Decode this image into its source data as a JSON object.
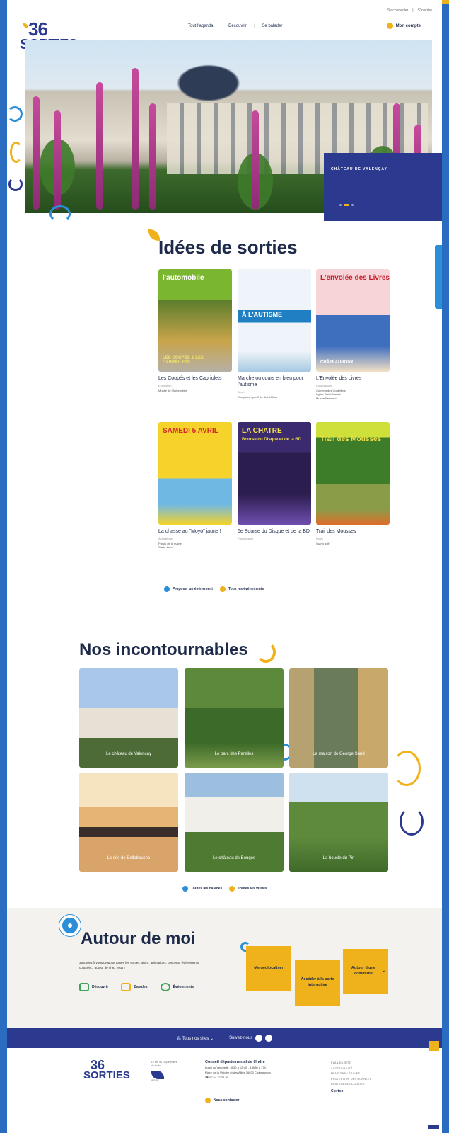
{
  "header": {
    "utility_links": [
      "Se connecter",
      "S'inscrire"
    ],
    "logo": {
      "line1": "36",
      "line2": "SORTIES"
    },
    "nav": [
      "Tout l'agenda",
      "Découvrir",
      "Se balader"
    ],
    "account_label": "Mon compte"
  },
  "hero": {
    "caption": "CHÂTEAU DE VALENÇAY"
  },
  "ideas": {
    "heading": "Idées de sorties",
    "cards": [
      {
        "poster_top": "l'automobile",
        "poster_bottom": "LES COUPÉS & LES CABRIOLETS",
        "title": "Les Coupés et les Cabriolets",
        "category": "Exposition",
        "place": "Musée de l'Automobile"
      },
      {
        "poster_top": "À L'AUTISME",
        "poster_bottom": "",
        "title": "Marche ou cours en bleu pour l'autisme",
        "category": "Sport",
        "place": "Complexe sportif de Saint-Maur"
      },
      {
        "poster_top": "L'envolée des Livres",
        "poster_bottom": "CHÂTEAUROUX",
        "title": "L'Envolée des Livres",
        "category": "Forum/salon",
        "place": "Couvent des Cordeliers\nÉglise Saint-Martial\nMusée Bertrand"
      },
      {
        "poster_top": "SAMEDI 5 AVRIL",
        "poster_bottom": "",
        "title": "La chasse au \"Moyo\" jaune !",
        "category": "Animations",
        "place": "Parvis de la mairie\nStade Lord"
      },
      {
        "poster_top": "LA CHATRE",
        "poster_bottom": "Bourse du Disque et de la BD",
        "title": "6e Bourse du Disque et de la BD",
        "category": "Forum/salon",
        "place": ""
      },
      {
        "poster_top": "Trail des Mousses",
        "poster_bottom": "",
        "title": "Trail des Mousses",
        "category": "Sport",
        "place": "Swing golf"
      }
    ],
    "links": [
      "Proposer un événement",
      "Tous les événements"
    ]
  },
  "musts": {
    "heading": "Nos incontournables",
    "tiles": [
      "Le château de Valençay",
      "Le parc des Parelles",
      "La maison de George Sand",
      "Le site de Bellebouche",
      "Le château de Bouges",
      "La boucle du Pin"
    ],
    "links": [
      "Toutes les balades",
      "Toutes les visites"
    ]
  },
  "around": {
    "heading": "Autour de moi",
    "text": "36sorties.fr vous propose toutes les sorties loisirs, animations, concerts, événements culturels... autour de chez vous !",
    "categories": [
      "Découvrir",
      "Balades",
      "Événements"
    ],
    "buttons": [
      "Me géolocaliser",
      "Accéder à la carte interactive",
      "Autour d'une commune"
    ]
  },
  "footer": {
    "band_sites": "Tous nos sites",
    "band_follow": "Suivez-nous",
    "dept_label": "Le site du Département de l'Indre",
    "dept_name": "INDRE",
    "contact_title": "Conseil départemental de l'Indre",
    "contact_hours": "Lundi au Vendredi : 8h30 à 12h30 - 13h30 à 17h",
    "contact_address": "Place de la Victoire et des Alliés 36020 Châteauroux",
    "contact_phone": "02 54 27 34 36",
    "contact_cta": "Nous contacter",
    "legal": [
      "PLAN DU SITE",
      "ACCESSIBILITÉ",
      "MENTIONS LÉGALES",
      "PROTECTION DES DONNÉES",
      "GESTION DES COOKIES"
    ],
    "credit": "Cortex"
  },
  "colors": {
    "accent": "#f0b21b",
    "primary": "#2b3a8f",
    "blue": "#2a8fd8"
  }
}
